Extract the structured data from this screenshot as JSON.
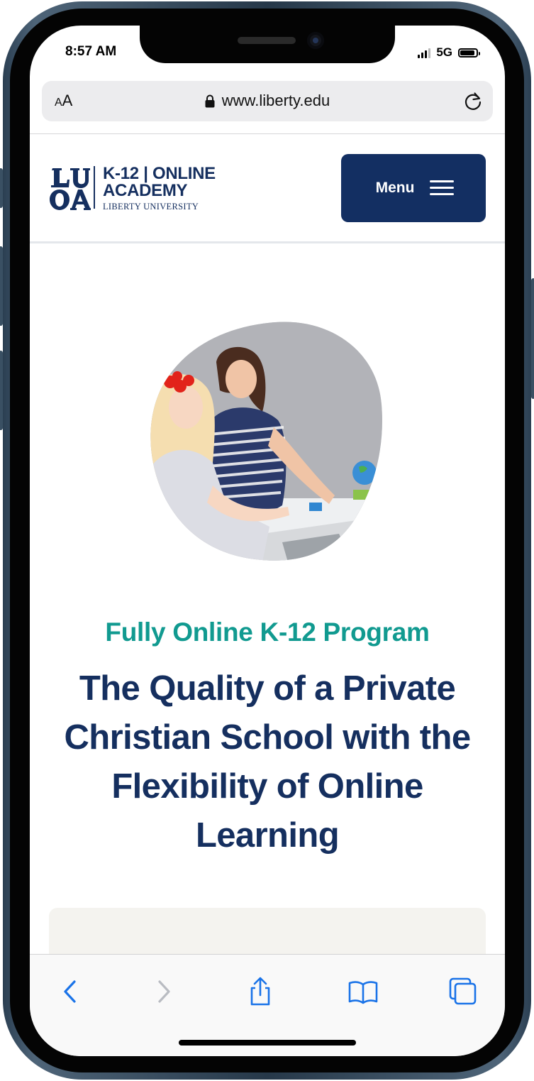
{
  "status_bar": {
    "time": "8:57 AM",
    "network": "5G",
    "signal_bars_active": 3,
    "battery_level": 0.9
  },
  "browser": {
    "text_size_button": {
      "small": "A",
      "large": "A"
    },
    "url": "www.liberty.edu",
    "icons": {
      "lock": "lock-icon",
      "reload": "reload-icon",
      "back": "back-chevron-icon",
      "forward": "forward-chevron-icon",
      "share": "share-icon",
      "bookmarks": "book-icon",
      "tabs": "tabs-icon"
    },
    "accent_color": "#1a73e8",
    "back_enabled": true,
    "forward_enabled": false
  },
  "site_header": {
    "logo": {
      "monogram": "LUOA",
      "line1": "K-12 | ONLINE",
      "line2": "ACADEMY",
      "line3": "LIBERTY UNIVERSITY"
    },
    "menu_button": {
      "label": "Menu",
      "icon": "hamburger-icon"
    }
  },
  "hero": {
    "eyebrow": "Fully Online K-12 Program",
    "headline": "The Quality of a Private Christian School with the Flexibility of Online Learning"
  },
  "colors": {
    "navy": "#152f5f",
    "teal": "#119a90",
    "card_background": "#f4f3ef"
  }
}
